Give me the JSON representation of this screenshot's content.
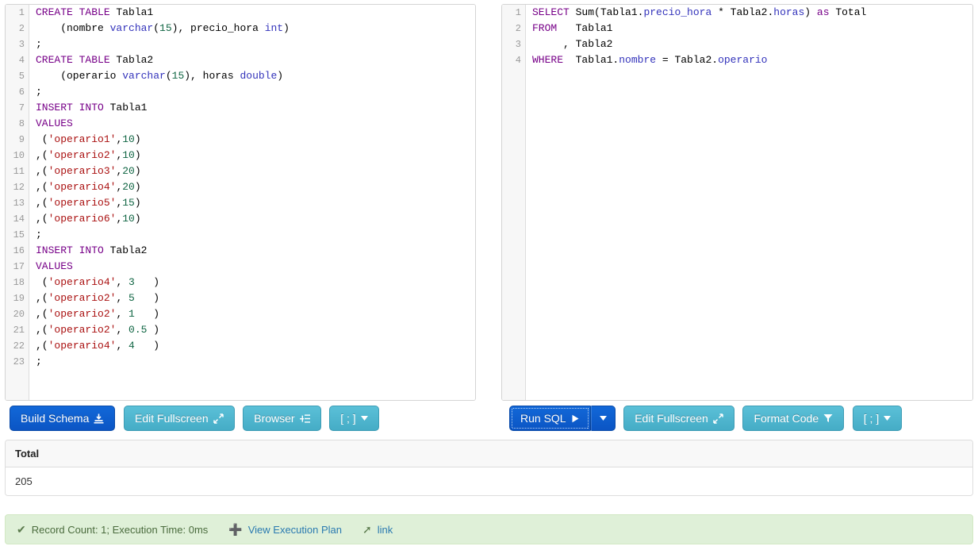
{
  "schema_editor": {
    "name": "schema-panel",
    "lines": [
      [
        {
          "t": "CREATE TABLE ",
          "c": "kw"
        },
        {
          "t": "Tabla1",
          "c": "pln"
        }
      ],
      [
        {
          "t": "    (nombre ",
          "c": "pln"
        },
        {
          "t": "varchar",
          "c": "typ"
        },
        {
          "t": "(",
          "c": "pln"
        },
        {
          "t": "15",
          "c": "num"
        },
        {
          "t": "), precio_hora ",
          "c": "pln"
        },
        {
          "t": "int",
          "c": "typ"
        },
        {
          "t": ")",
          "c": "pln"
        }
      ],
      [
        {
          "t": ";",
          "c": "pln"
        }
      ],
      [
        {
          "t": "CREATE TABLE ",
          "c": "kw"
        },
        {
          "t": "Tabla2",
          "c": "pln"
        }
      ],
      [
        {
          "t": "    (operario ",
          "c": "pln"
        },
        {
          "t": "varchar",
          "c": "typ"
        },
        {
          "t": "(",
          "c": "pln"
        },
        {
          "t": "15",
          "c": "num"
        },
        {
          "t": "), horas ",
          "c": "pln"
        },
        {
          "t": "double",
          "c": "typ"
        },
        {
          "t": ")",
          "c": "pln"
        }
      ],
      [
        {
          "t": ";",
          "c": "pln"
        }
      ],
      [
        {
          "t": "INSERT INTO ",
          "c": "kw"
        },
        {
          "t": "Tabla1",
          "c": "pln"
        }
      ],
      [
        {
          "t": "VALUES",
          "c": "kw"
        }
      ],
      [
        {
          "t": " (",
          "c": "pln"
        },
        {
          "t": "'operario1'",
          "c": "str"
        },
        {
          "t": ",",
          "c": "pln"
        },
        {
          "t": "10",
          "c": "num"
        },
        {
          "t": ")",
          "c": "pln"
        }
      ],
      [
        {
          "t": ",(",
          "c": "pln"
        },
        {
          "t": "'operario2'",
          "c": "str"
        },
        {
          "t": ",",
          "c": "pln"
        },
        {
          "t": "10",
          "c": "num"
        },
        {
          "t": ")",
          "c": "pln"
        }
      ],
      [
        {
          "t": ",(",
          "c": "pln"
        },
        {
          "t": "'operario3'",
          "c": "str"
        },
        {
          "t": ",",
          "c": "pln"
        },
        {
          "t": "20",
          "c": "num"
        },
        {
          "t": ")",
          "c": "pln"
        }
      ],
      [
        {
          "t": ",(",
          "c": "pln"
        },
        {
          "t": "'operario4'",
          "c": "str"
        },
        {
          "t": ",",
          "c": "pln"
        },
        {
          "t": "20",
          "c": "num"
        },
        {
          "t": ")",
          "c": "pln"
        }
      ],
      [
        {
          "t": ",(",
          "c": "pln"
        },
        {
          "t": "'operario5'",
          "c": "str"
        },
        {
          "t": ",",
          "c": "pln"
        },
        {
          "t": "15",
          "c": "num"
        },
        {
          "t": ")",
          "c": "pln"
        }
      ],
      [
        {
          "t": ",(",
          "c": "pln"
        },
        {
          "t": "'operario6'",
          "c": "str"
        },
        {
          "t": ",",
          "c": "pln"
        },
        {
          "t": "10",
          "c": "num"
        },
        {
          "t": ")",
          "c": "pln"
        }
      ],
      [
        {
          "t": ";",
          "c": "pln"
        }
      ],
      [
        {
          "t": "INSERT INTO ",
          "c": "kw"
        },
        {
          "t": "Tabla2",
          "c": "pln"
        }
      ],
      [
        {
          "t": "VALUES",
          "c": "kw"
        }
      ],
      [
        {
          "t": " (",
          "c": "pln"
        },
        {
          "t": "'operario4'",
          "c": "str"
        },
        {
          "t": ", ",
          "c": "pln"
        },
        {
          "t": "3",
          "c": "num"
        },
        {
          "t": "   )",
          "c": "pln"
        }
      ],
      [
        {
          "t": ",(",
          "c": "pln"
        },
        {
          "t": "'operario2'",
          "c": "str"
        },
        {
          "t": ", ",
          "c": "pln"
        },
        {
          "t": "5",
          "c": "num"
        },
        {
          "t": "   )",
          "c": "pln"
        }
      ],
      [
        {
          "t": ",(",
          "c": "pln"
        },
        {
          "t": "'operario2'",
          "c": "str"
        },
        {
          "t": ", ",
          "c": "pln"
        },
        {
          "t": "1",
          "c": "num"
        },
        {
          "t": "   )",
          "c": "pln"
        }
      ],
      [
        {
          "t": ",(",
          "c": "pln"
        },
        {
          "t": "'operario2'",
          "c": "str"
        },
        {
          "t": ", ",
          "c": "pln"
        },
        {
          "t": "0.5",
          "c": "num"
        },
        {
          "t": " )",
          "c": "pln"
        }
      ],
      [
        {
          "t": ",(",
          "c": "pln"
        },
        {
          "t": "'operario4'",
          "c": "str"
        },
        {
          "t": ", ",
          "c": "pln"
        },
        {
          "t": "4",
          "c": "num"
        },
        {
          "t": "   )",
          "c": "pln"
        }
      ],
      [
        {
          "t": ";",
          "c": "pln"
        }
      ]
    ]
  },
  "query_editor": {
    "name": "query-panel",
    "lines": [
      [
        {
          "t": "SELECT ",
          "c": "kw"
        },
        {
          "t": "Sum(Tabla1.",
          "c": "pln"
        },
        {
          "t": "precio_hora",
          "c": "col"
        },
        {
          "t": " * Tabla2.",
          "c": "pln"
        },
        {
          "t": "horas",
          "c": "col"
        },
        {
          "t": ") ",
          "c": "pln"
        },
        {
          "t": "as",
          "c": "kw"
        },
        {
          "t": " Total",
          "c": "pln"
        }
      ],
      [
        {
          "t": "FROM",
          "c": "kw"
        },
        {
          "t": "   Tabla1",
          "c": "pln"
        }
      ],
      [
        {
          "t": "     , Tabla2",
          "c": "pln"
        }
      ],
      [
        {
          "t": "WHERE",
          "c": "kw"
        },
        {
          "t": "  Tabla1.",
          "c": "pln"
        },
        {
          "t": "nombre",
          "c": "col"
        },
        {
          "t": " = Tabla2.",
          "c": "pln"
        },
        {
          "t": "operario",
          "c": "col"
        }
      ]
    ]
  },
  "schema_toolbar": {
    "build_schema_label": "Build Schema",
    "build_schema_icon": "import-icon",
    "edit_fullscreen_label": "Edit Fullscreen",
    "edit_fullscreen_icon": "expand-arrows-icon",
    "browser_label": "Browser",
    "browser_icon": "indent-list-icon",
    "terminator_label": "[ ; ]",
    "terminator_icon": "caret-down-icon"
  },
  "query_toolbar": {
    "run_sql_label": "Run SQL",
    "run_sql_icon": "play-icon",
    "run_sql_caret_icon": "caret-down-icon",
    "edit_fullscreen_label": "Edit Fullscreen",
    "edit_fullscreen_icon": "expand-arrows-icon",
    "format_code_label": "Format Code",
    "format_code_icon": "filter-icon",
    "terminator_label": "[ ; ]",
    "terminator_icon": "caret-down-icon"
  },
  "results": {
    "columns": [
      "Total"
    ],
    "rows": [
      [
        "205"
      ]
    ]
  },
  "status": {
    "check_icon": "check-icon",
    "summary": "Record Count: 1; Execution Time: 0ms",
    "plan_icon": "plus-icon",
    "plan_label": "View Execution Plan",
    "link_icon": "share-arrow-icon",
    "link_label": "link"
  },
  "colors": {
    "primary_button": "#0b55c4",
    "secondary_button": "#45acc6",
    "alert_background": "#dff0d8",
    "keyword": "#770088",
    "type": "#3333bb",
    "string": "#aa1111",
    "number": "#116644",
    "column": "#3333bb"
  }
}
